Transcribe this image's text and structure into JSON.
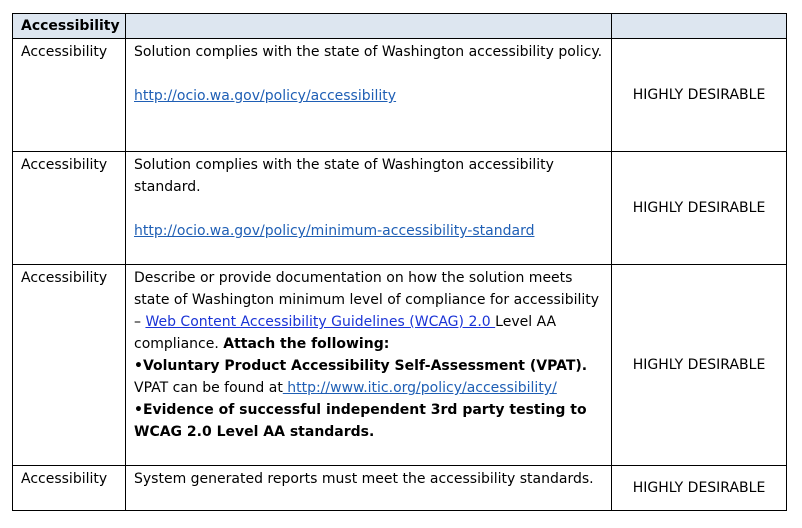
{
  "header": {
    "col1": "Accessibility",
    "col2": "",
    "col3": ""
  },
  "rows": [
    {
      "category": "Accessibility",
      "text": "Solution complies with the state of Washington accessibility policy.",
      "link": "http://ocio.wa.gov/policy/accessibility",
      "priority": "HIGHLY DESIRABLE"
    },
    {
      "category": "Accessibility",
      "text": "Solution complies with the state of Washington accessibility standard.",
      "link": "http://ocio.wa.gov/policy/minimum-accessibility-standard",
      "priority": "HIGHLY DESIRABLE"
    },
    {
      "category": "Accessibility",
      "text_a": "Describe or provide documentation on how the solution meets state of Washington minimum level of compliance for accessibility – ",
      "link_wcag": "Web Content Accessibility Guidelines (WCAG) 2.0 ",
      "text_b": "Level AA compliance. ",
      "attach": "Attach the following:",
      "bullet1": "•Voluntary Product Accessibility Self-Assessment (VPAT).",
      "vpat_text": "VPAT can be found at",
      "vpat_link": " http://www.itic.org/policy/accessibility/",
      "bullet2": "•Evidence of successful independent 3rd party testing to WCAG 2.0 Level AA standards.",
      "priority": "HIGHLY DESIRABLE"
    },
    {
      "category": "Accessibility",
      "text": "System generated reports must meet the accessibility standards.",
      "priority": "HIGHLY DESIRABLE"
    }
  ]
}
